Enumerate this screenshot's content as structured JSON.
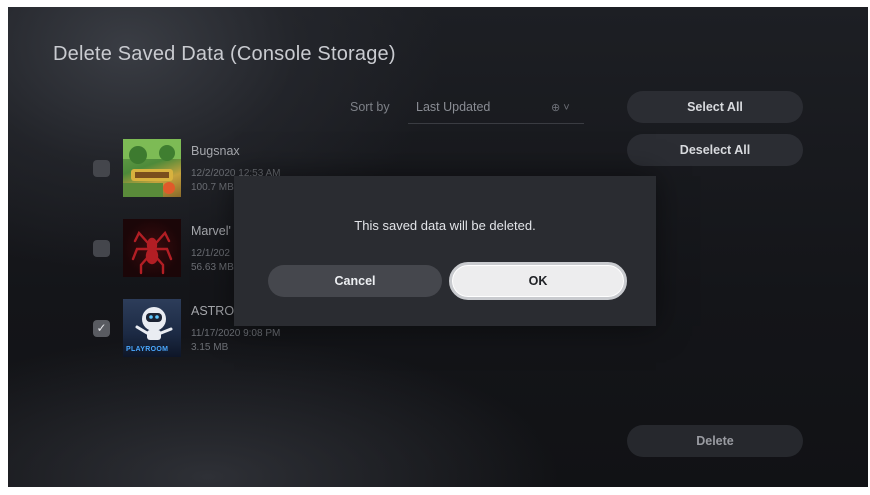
{
  "header": {
    "title": "Delete Saved Data (Console Storage)"
  },
  "sort": {
    "label": "Sort by",
    "value": "Last Updated",
    "icon": "options-icon"
  },
  "actions": {
    "select_all": "Select All",
    "deselect_all": "Deselect All",
    "delete": "Delete"
  },
  "games": [
    {
      "name": "Bugsnax",
      "date": "12/2/2020 12:53 AM",
      "size": "100.7 MB",
      "checked": false
    },
    {
      "name": "Marvel'",
      "date": "12/1/202",
      "size": "56.63 MB",
      "checked": false
    },
    {
      "name": "ASTRO'",
      "date": "11/17/2020 9:08 PM",
      "size": "3.15 MB",
      "checked": true
    }
  ],
  "thumbnail_text": {
    "astro_logo": "PLAYROOM"
  },
  "dialog": {
    "message": "This saved data will be deleted.",
    "cancel": "Cancel",
    "ok": "OK"
  }
}
